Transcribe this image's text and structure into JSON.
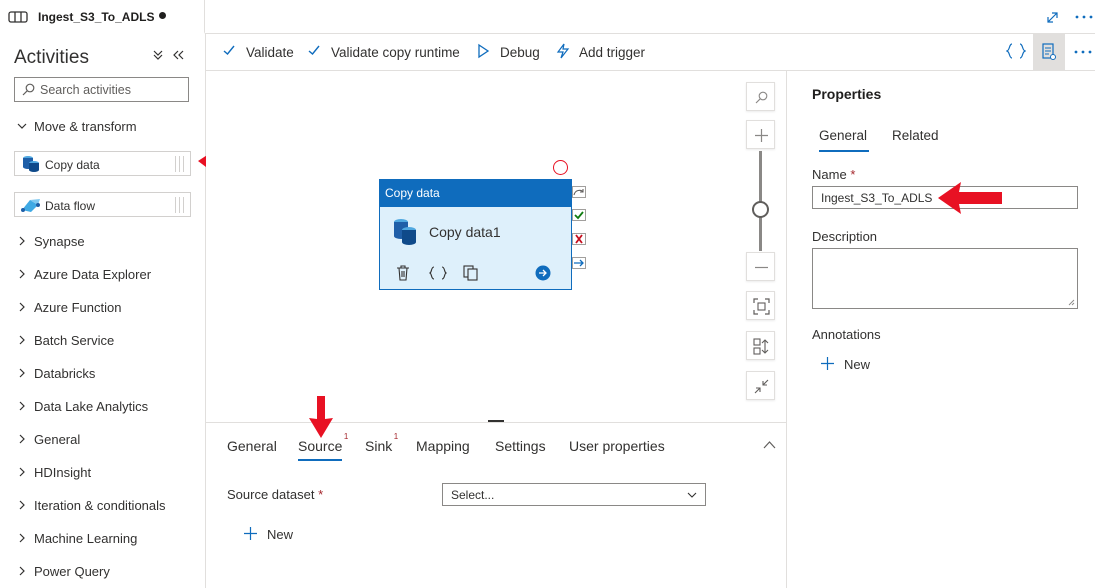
{
  "tab": {
    "title": "Ingest_S3_To_ADLS"
  },
  "activities": {
    "heading": "Activities",
    "search_placeholder": "Search activities",
    "move_transform": "Move & transform",
    "items": [
      {
        "label": "Copy data"
      },
      {
        "label": "Data flow"
      }
    ],
    "categories": [
      "Synapse",
      "Azure Data Explorer",
      "Azure Function",
      "Batch Service",
      "Databricks",
      "Data Lake Analytics",
      "General",
      "HDInsight",
      "Iteration & conditionals",
      "Machine Learning",
      "Power Query"
    ]
  },
  "toolbar": {
    "validate": "Validate",
    "validate_copy_runtime": "Validate copy runtime",
    "debug": "Debug",
    "add_trigger": "Add trigger"
  },
  "node": {
    "type_label": "Copy data",
    "name": "Copy data1"
  },
  "bottom_tabs": [
    {
      "label": "General",
      "badge": ""
    },
    {
      "label": "Source",
      "badge": "1"
    },
    {
      "label": "Sink",
      "badge": "1"
    },
    {
      "label": "Mapping",
      "badge": ""
    },
    {
      "label": "Settings",
      "badge": ""
    },
    {
      "label": "User properties",
      "badge": ""
    }
  ],
  "source": {
    "dataset_label": "Source dataset",
    "required_mark": "*",
    "select_value": "Select...",
    "new_label": "New"
  },
  "properties": {
    "title": "Properties",
    "tabs": [
      "General",
      "Related"
    ],
    "name_label": "Name",
    "required_mark": "*",
    "name_value": "Ingest_S3_To_ADLS",
    "description_label": "Description",
    "description_value": "",
    "annotations_label": "Annotations",
    "new_label": "New"
  },
  "colors": {
    "accent": "#0f6cbd",
    "node_fill": "#def0fb",
    "annotation_arrow": "#e81123",
    "required": "#a4262c"
  }
}
